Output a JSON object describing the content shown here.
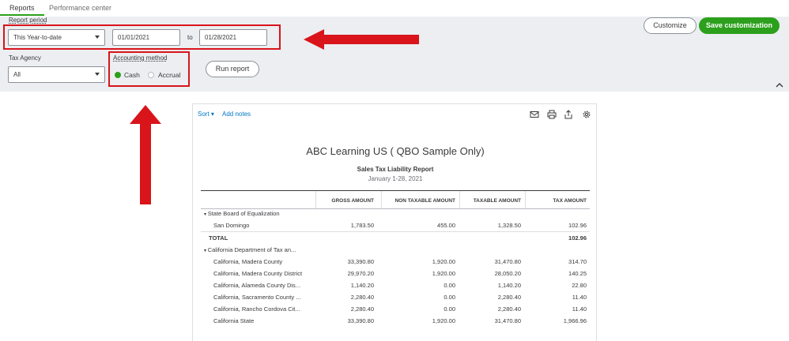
{
  "tabs": [
    {
      "label": "Reports"
    },
    {
      "label": "Performance center"
    }
  ],
  "filters": {
    "report_period_label": "Report period",
    "report_period_value": "This Year-to-date",
    "date_from": "01/01/2021",
    "to_label": "to",
    "date_to": "01/28/2021",
    "tax_agency_label": "Tax Agency",
    "tax_agency_value": "All",
    "accounting_method_label": "Accounting method",
    "cash_label": "Cash",
    "accrual_label": "Accrual",
    "run_report_label": "Run report"
  },
  "actions": {
    "customize_label": "Customize",
    "save_customization_label": "Save customization"
  },
  "report": {
    "sort_label": "Sort",
    "add_notes_label": "Add notes",
    "company": "ABC Learning US ( QBO Sample Only)",
    "name": "Sales Tax Liability Report",
    "date_range": "January 1-28, 2021",
    "columns": [
      "",
      "GROSS AMOUNT",
      "NON TAXABLE AMOUNT",
      "TAXABLE AMOUNT",
      "TAX AMOUNT"
    ],
    "rows": [
      {
        "name": "State Board of Equalization",
        "gross": "",
        "non_taxable": "",
        "taxable": "",
        "tax": ""
      },
      {
        "name": "San Domingo",
        "gross": "1,783.50",
        "non_taxable": "455.00",
        "taxable": "1,328.50",
        "tax": "102.96"
      },
      {
        "name": "TOTAL",
        "gross": "",
        "non_taxable": "",
        "taxable": "",
        "tax": "102.96"
      },
      {
        "name": "California Department of Tax an...",
        "gross": "",
        "non_taxable": "",
        "taxable": "",
        "tax": ""
      },
      {
        "name": "California, Madera County",
        "gross": "33,390.80",
        "non_taxable": "1,920.00",
        "taxable": "31,470.80",
        "tax": "314.70"
      },
      {
        "name": "California, Madera County District",
        "gross": "29,970.20",
        "non_taxable": "1,920.00",
        "taxable": "28,050.20",
        "tax": "140.25"
      },
      {
        "name": "California, Alameda County Dis...",
        "gross": "1,140.20",
        "non_taxable": "0.00",
        "taxable": "1,140.20",
        "tax": "22.80"
      },
      {
        "name": "California, Sacramento County ...",
        "gross": "2,280.40",
        "non_taxable": "0.00",
        "taxable": "2,280.40",
        "tax": "11.40"
      },
      {
        "name": "California, Rancho Cordova Cit...",
        "gross": "2,280.40",
        "non_taxable": "0.00",
        "taxable": "2,280.40",
        "tax": "11.40"
      },
      {
        "name": "California State",
        "gross": "33,390.80",
        "non_taxable": "1,920.00",
        "taxable": "31,470.80",
        "tax": "1,966.96"
      }
    ]
  },
  "colors": {
    "accent_green": "#2ca01c",
    "link_blue": "#0077c5",
    "annotation_red": "#d9141b",
    "panel_gray": "#eceef1"
  }
}
